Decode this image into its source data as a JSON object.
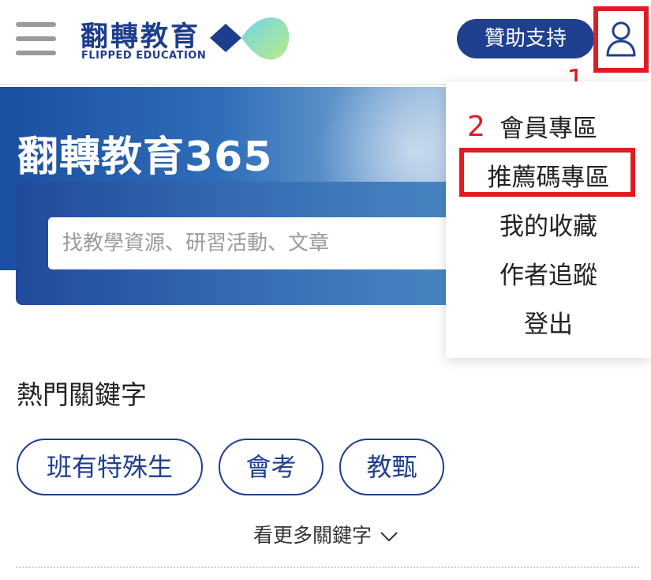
{
  "header": {
    "logo_zh": "翻轉教育",
    "logo_en": "FLIPPED EDUCATION",
    "sponsor_label": "贊助支持",
    "icons": {
      "menu": "hamburger-icon",
      "user": "user-icon"
    }
  },
  "banner": {
    "title": "翻轉教育365",
    "search_placeholder": "找教學資源、研習活動、文章"
  },
  "user_menu": {
    "items": [
      {
        "label": "會員專區"
      },
      {
        "label": "推薦碼專區"
      },
      {
        "label": "我的收藏"
      },
      {
        "label": "作者追蹤"
      },
      {
        "label": "登出"
      }
    ]
  },
  "annotations": {
    "step1": "1",
    "step2": "2"
  },
  "keywords": {
    "title": "熱門關鍵字",
    "chips": [
      "班有特殊生",
      "會考",
      "教甄"
    ],
    "see_more": "看更多關鍵字"
  },
  "colors": {
    "brand": "#1f3f8f",
    "highlight": "#e01c22"
  }
}
